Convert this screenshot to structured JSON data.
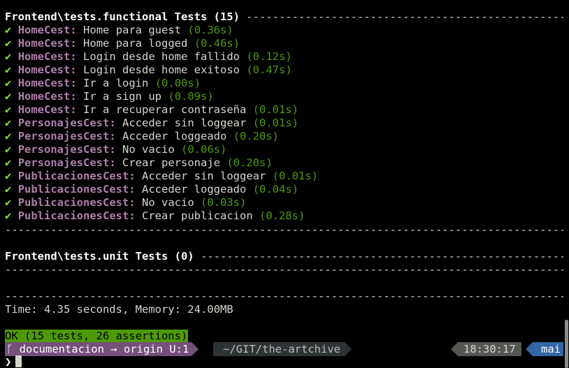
{
  "functional": {
    "header": "Frontend\\tests.functional Tests (15)",
    "tests": [
      {
        "check": "✔",
        "class": "HomeCest:",
        "name": "Home para guest",
        "time": "(0.36s)"
      },
      {
        "check": "✔",
        "class": "HomeCest:",
        "name": "Home para logged",
        "time": "(0.46s)"
      },
      {
        "check": "✔",
        "class": "HomeCest:",
        "name": "Login desde home fallido",
        "time": "(0.12s)"
      },
      {
        "check": "✔",
        "class": "HomeCest:",
        "name": "Login desde home exitoso",
        "time": "(0.47s)"
      },
      {
        "check": "✔",
        "class": "HomeCest:",
        "name": "Ir a login",
        "time": "(0.00s)"
      },
      {
        "check": "✔",
        "class": "HomeCest:",
        "name": "Ir a sign up",
        "time": "(0.09s)"
      },
      {
        "check": "✔",
        "class": "HomeCest:",
        "name": "Ir a recuperar contraseña",
        "time": "(0.01s)"
      },
      {
        "check": "✔",
        "class": "PersonajesCest:",
        "name": "Acceder sin loggear",
        "time": "(0.01s)"
      },
      {
        "check": "✔",
        "class": "PersonajesCest:",
        "name": "Acceder loggeado",
        "time": "(0.20s)"
      },
      {
        "check": "✔",
        "class": "PersonajesCest:",
        "name": "No vacio",
        "time": "(0.06s)"
      },
      {
        "check": "✔",
        "class": "PersonajesCest:",
        "name": "Crear personaje",
        "time": "(0.20s)"
      },
      {
        "check": "✔",
        "class": "PublicacionesCest:",
        "name": "Acceder sin loggear",
        "time": "(0.01s)"
      },
      {
        "check": "✔",
        "class": "PublicacionesCest:",
        "name": "Acceder loggeado",
        "time": "(0.04s)"
      },
      {
        "check": "✔",
        "class": "PublicacionesCest:",
        "name": "No vacio",
        "time": "(0.03s)"
      },
      {
        "check": "✔",
        "class": "PublicacionesCest:",
        "name": "Crear publicacion",
        "time": "(0.28s)"
      }
    ]
  },
  "unit": {
    "header": "Frontend\\tests.unit Tests (0)"
  },
  "summary": {
    "time_memory": "Time: 4.35 seconds, Memory: 24.00MB",
    "ok": "OK (15 tests, 26 assertions)"
  },
  "statusbar": {
    "branch_icon": "ᚴ",
    "branch": "documentacion → origin U:1",
    "path": "~/GIT/the-artchive",
    "time": "18:30:17",
    "user": "mai"
  },
  "prompt": {
    "symbol": "❯"
  },
  "colors": {
    "background": "#000000",
    "pass": "#8ae234",
    "duration": "#4e9a06",
    "class": "#ad7fa8",
    "ok_background": "#4e9a06",
    "branch_segment": "#75507b",
    "user_segment": "#3465a4"
  }
}
